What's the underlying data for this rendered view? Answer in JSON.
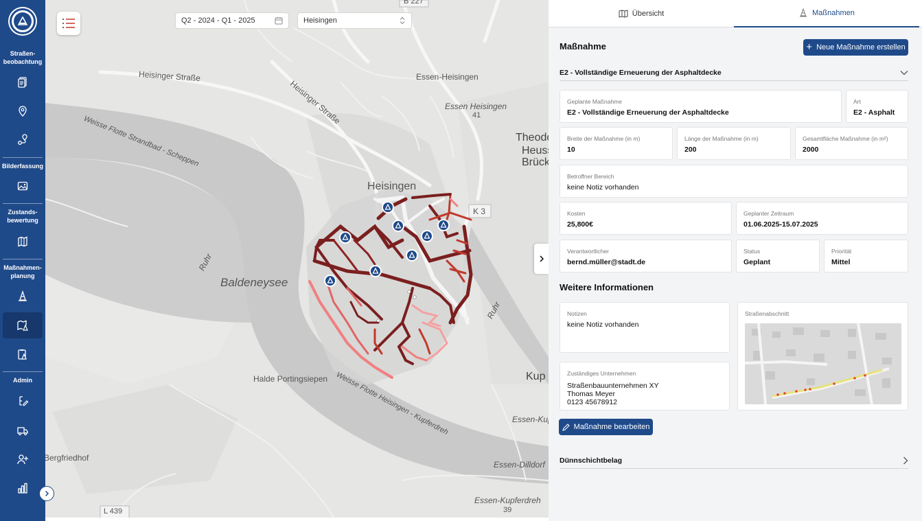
{
  "sidebar": {
    "sections": [
      {
        "label": "Straßen-\nbeobachtung",
        "lines": [
          "Straßen-",
          "beobachtung"
        ]
      },
      {
        "label": "Bilderfassung",
        "lines": [
          "Bilderfassung"
        ]
      },
      {
        "label": "Zustands-\nbewertung",
        "lines": [
          "Zustands-",
          "bewertung"
        ]
      },
      {
        "label": "Maßnahmen-\nplanung",
        "lines": [
          "Maßnahmen-",
          "planung"
        ]
      },
      {
        "label": "Admin",
        "lines": [
          "Admin"
        ]
      }
    ],
    "icons": [
      "documents-icon",
      "location-pin-icon",
      "route-icon",
      "image-icon",
      "map-rating-icon",
      "construction-cone-icon",
      "map-cone-icon",
      "clipboard-cone-icon",
      "edit-list-icon",
      "truck-icon",
      "add-user-icon",
      "bar-chart-icon"
    ],
    "brand_color": "#1f4a8a"
  },
  "map": {
    "date_range": "Q2 - 2024 - Q1 - 2025",
    "district": "Heisingen",
    "labels": {
      "b227": "B 227",
      "heisinger_strasse_1": "Heisinger Straße",
      "heisinger_strasse_2": "Heisinger Straße",
      "essen_heisingen_1": "Essen-Heisingen",
      "essen_heisingen_2": "Essen Heisingen",
      "num_41": "41",
      "theodor": "Theodor",
      "heuss": "Heuss",
      "bruck": "Brück",
      "weisse_flotte": "Weisse Flotte Strandbad - Scheppen",
      "heisingen": "Heisingen",
      "k3": "K 3",
      "ruhr_1": "Ruhr",
      "baldeneysee": "Baldeneysee",
      "ruhr_2": "Ruhr",
      "halde": "Halde Portingsiepen",
      "weisse_flotte_2": "Weisse Flotte Heisingen - Kupferdreh",
      "kup": "Kup",
      "essen_kupf_1": "Essen-Kupf",
      "bergfriedhof": "Bergfriedhof",
      "essen_dilldorf": "Essen-Dilldorf",
      "essen_kupferdreh": "Essen-Kupferdreh",
      "num_39": "39",
      "l439": "L 439"
    }
  },
  "panel": {
    "tabs": [
      {
        "label": "Übersicht",
        "icon": "map-icon",
        "active": false
      },
      {
        "label": "Maßnahmen",
        "icon": "construction-cone-icon",
        "active": true
      }
    ],
    "title": "Maßnahme",
    "new_button": "Neue Maßnahme erstellen",
    "accordion_open": "E2 - Vollständige Erneuerung der Asphaltdecke",
    "fields": {
      "geplante_label": "Geplante Maßnahme",
      "geplante_value": "E2 - Vollständige Erneuerung der Asphaltdecke",
      "art_label": "Art",
      "art_value": "E2 - Asphalt",
      "breite_label": "Breite der Maßnahme (in m)",
      "breite_value": "10",
      "laenge_label": "Länge der Maßnahme (in m)",
      "laenge_value": "200",
      "flaeche_label": "Gesamtfläche Maßnahme (in m²)",
      "flaeche_value": "2000",
      "bereich_label": "Betroffner Bereich",
      "bereich_value": "keine Notiz vorhanden",
      "kosten_label": "Kosten",
      "kosten_value": "25,800€",
      "zeitraum_label": "Geplanter Zeitraum",
      "zeitraum_value": "01.06.2025-15.07.2025",
      "verantwortlich_label": "Verantwortlicher",
      "verantwortlich_value": "bernd.müller@stadt.de",
      "status_label": "Status",
      "status_value": "Geplant",
      "prioritaet_label": "Priorität",
      "prioritaet_value": "Mittel"
    },
    "weitere_title": "Weitere Informationen",
    "notizen_label": "Notizen",
    "notizen_value": "keine Notiz vorhanden",
    "strassenabschnitt_label": "Straßenabschnitt",
    "unternehmen_label": "Zuständiges Unternehmen",
    "unternehmen_lines": [
      "Straßenbauunternehmen XY",
      "Thomas Meyer",
      "0123 45678912"
    ],
    "edit_button": "Maßnahme bearbeiten",
    "accordion_closed": "Dünnschichtbelag"
  }
}
